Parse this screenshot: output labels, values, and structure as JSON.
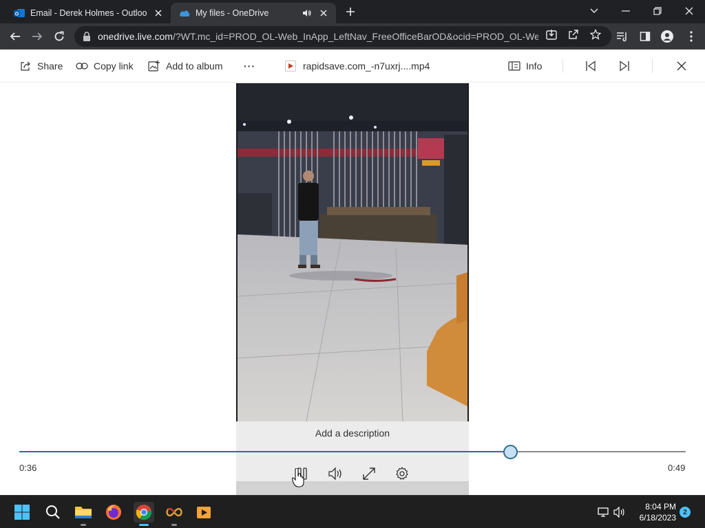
{
  "browser": {
    "tabs": [
      {
        "title": "Email - Derek Holmes - Outlook",
        "icon": "outlook-icon",
        "active": false
      },
      {
        "title": "My files - OneDrive",
        "icon": "onedrive-icon",
        "active": true,
        "audio": true
      }
    ],
    "url_host": "onedrive.live.com",
    "url_path": "/?WT.mc_id=PROD_OL-Web_InApp_LeftNav_FreeOfficeBarOD&ocid=PROD_OL-Web..."
  },
  "commandbar": {
    "share_label": "Share",
    "copy_link_label": "Copy link",
    "add_to_album_label": "Add to album",
    "more_label": "···",
    "filename": "rapidsave.com_-n7uxrj....mp4",
    "info_label": "Info"
  },
  "player": {
    "description_placeholder": "Add a description",
    "current_time": "0:36",
    "duration": "0:49",
    "progress_fraction": 0.737,
    "accent_color": "#2b6f8f"
  },
  "taskbar": {
    "apps": [
      "windows-start",
      "search",
      "file-explorer",
      "firefox",
      "chrome",
      "infinity-app",
      "media-player"
    ],
    "active_app": "chrome",
    "time": "8:04 PM",
    "date": "6/18/2023",
    "notifications": "2"
  }
}
